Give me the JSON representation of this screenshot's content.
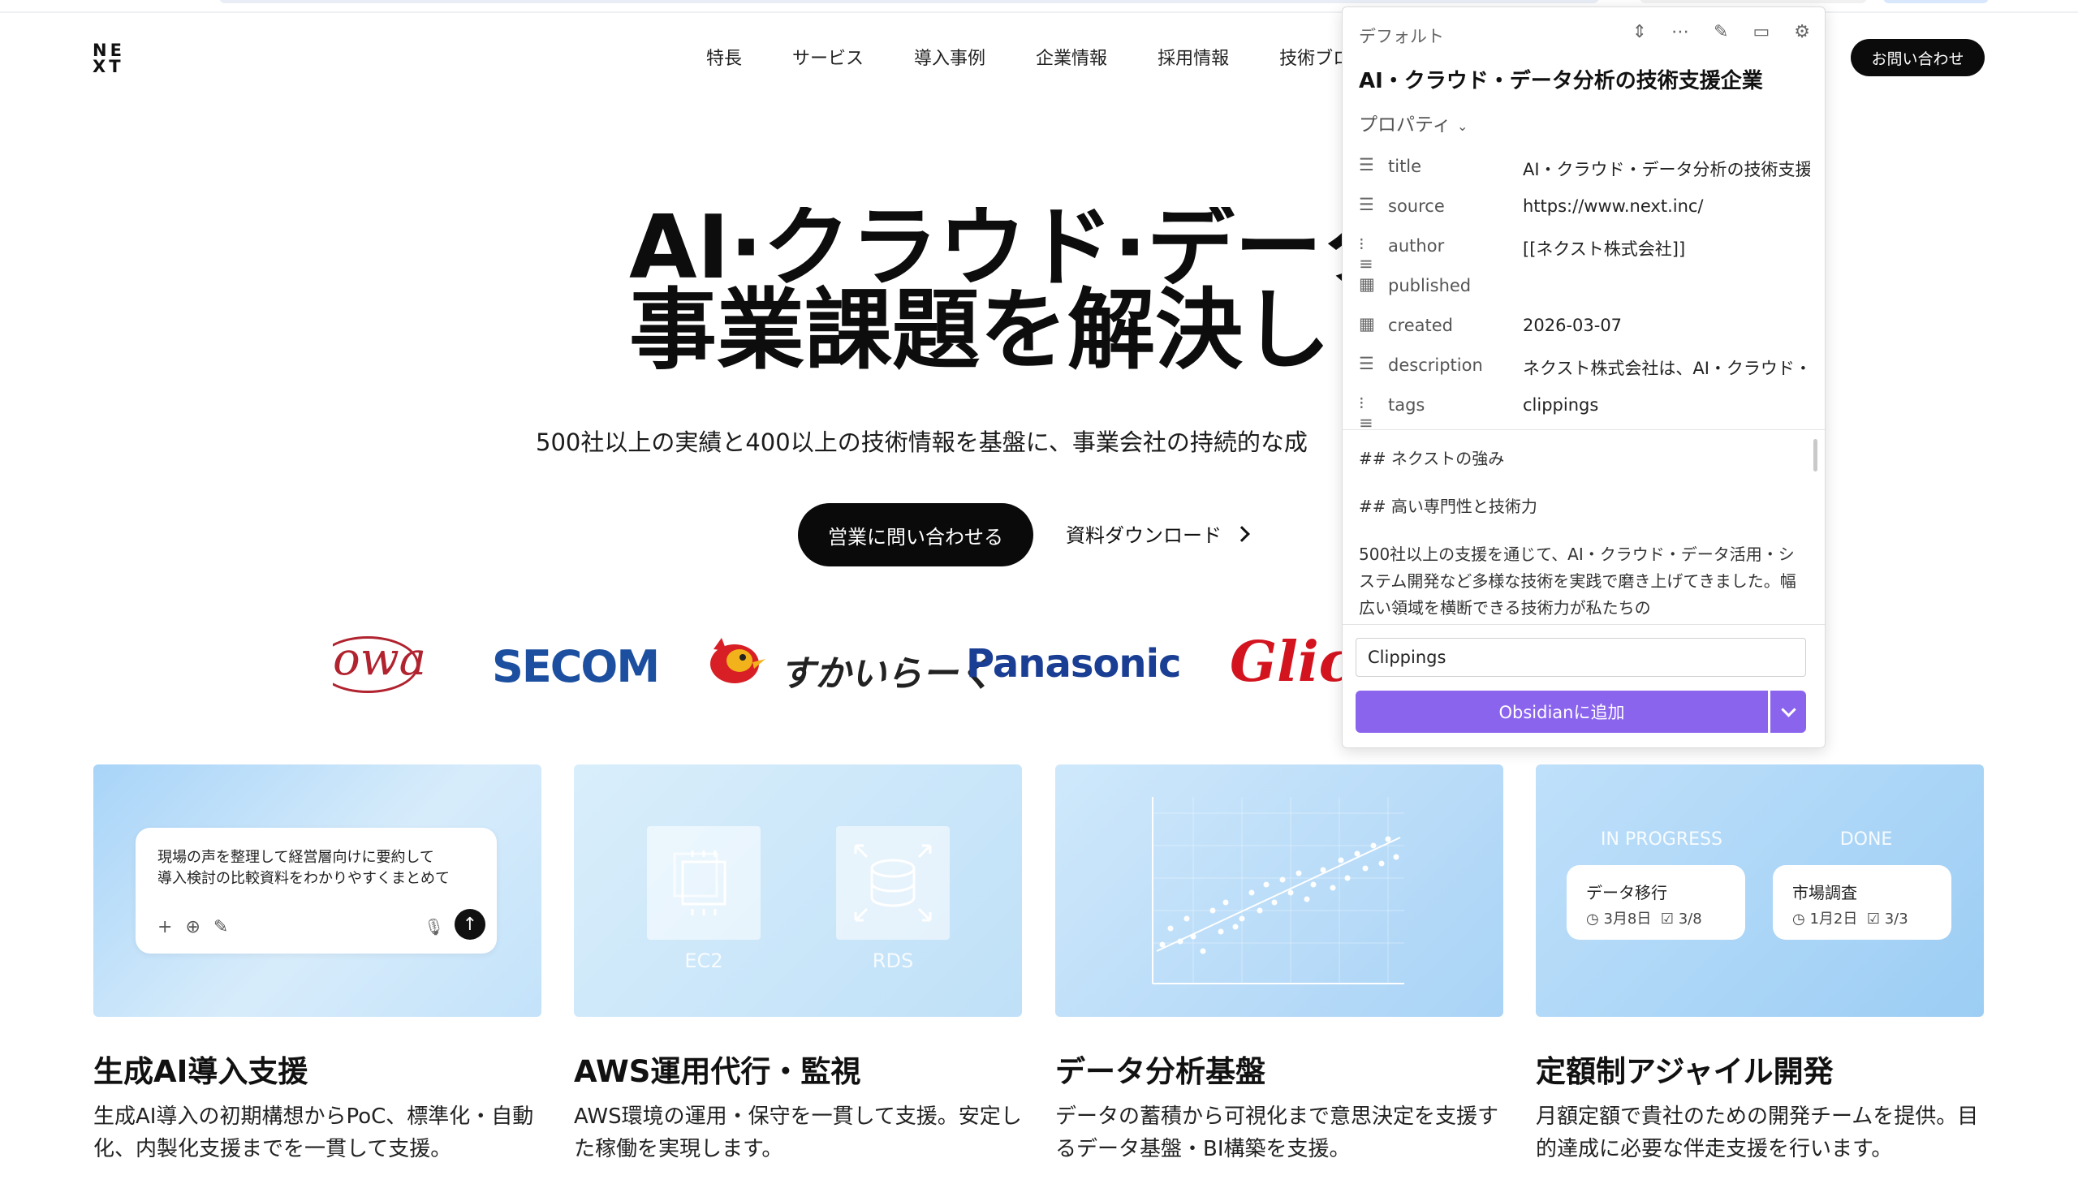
{
  "site": {
    "logo": "NE\nXT",
    "nav": [
      "特長",
      "サービス",
      "導入事例",
      "企業情報",
      "採用情報",
      "技術ブロ"
    ],
    "contact_label": "お問い合わせ"
  },
  "hero": {
    "title_line1": "AI·クラウド·データ",
    "title_line2": "事業課題を解決しま",
    "subtitle": "500社以上の実績と400以上の技術情報を基盤に、事業会社の持続的な成",
    "cta_primary": "営業に問い合わせる",
    "cta_secondary": "資料ダウンロード"
  },
  "clients": {
    "owa": "owa",
    "secom": "SECOM",
    "sukiya": "すかいらーく",
    "panasonic": "Panasonic",
    "glico": "Glico"
  },
  "services": [
    {
      "title": "生成AI導入支援",
      "desc": "生成AI導入の初期構想からPoC、標準化・自動化、内製化支援までを一貫して支援。",
      "prompt": "現場の声を整理して経営層向けに要約して\n導入検討の比較資料をわかりやすくまとめて"
    },
    {
      "title": "AWS運用代行・監視",
      "desc": "AWS環境の運用・保守を一貫して支援。安定した稼働を実現します。",
      "tile1": "EC2",
      "tile2": "RDS"
    },
    {
      "title": "データ分析基盤",
      "desc": "データの蓄積から可視化まで意思決定を支援するデータ基盤・BI構築を支援。"
    },
    {
      "title": "定額制アジャイル開発",
      "desc": "月額定額で貴社のための開発チームを提供。目的達成に必要な伴走支援を行います。",
      "col1": "IN PROGRESS",
      "col2": "DONE",
      "task1_title": "データ移行",
      "task1_date": "3月8日",
      "task1_check": "3/8",
      "task2_title": "市場調査",
      "task2_date": "1月2日",
      "task2_check": "3/3"
    }
  ],
  "clipper": {
    "template": "デフォルト",
    "note_title": "AI・クラウド・データ分析の技術支援企業",
    "properties_label": "プロパティ",
    "properties": [
      {
        "key": "title",
        "value": "AI・クラウド・データ分析の技術支援",
        "icon": "text-icon"
      },
      {
        "key": "source",
        "value": "https://www.next.inc/",
        "icon": "text-icon"
      },
      {
        "key": "author",
        "value": "[[ネクスト株式会社]]",
        "icon": "list-icon"
      },
      {
        "key": "published",
        "value": "",
        "icon": "calendar-icon"
      },
      {
        "key": "created",
        "value": "2026-03-07",
        "icon": "calendar-icon"
      },
      {
        "key": "description",
        "value": "ネクスト株式会社は、AI・クラウド・",
        "icon": "text-icon"
      },
      {
        "key": "tags",
        "value": "clippings",
        "icon": "list-icon"
      }
    ],
    "content": [
      "## ネクストの強み",
      "## 高い専門性と技術力",
      "500社以上の支援を通じて、AI・クラウド・データ活用・システム開発など多様な技術を実践で磨き上げてきました。幅広い領域を横断できる技術力が私たちの"
    ],
    "folder": "Clippings",
    "add_button": "Obsidianに追加"
  },
  "colors": {
    "accent": "#8b64ee",
    "dark": "#0b0b0b"
  }
}
